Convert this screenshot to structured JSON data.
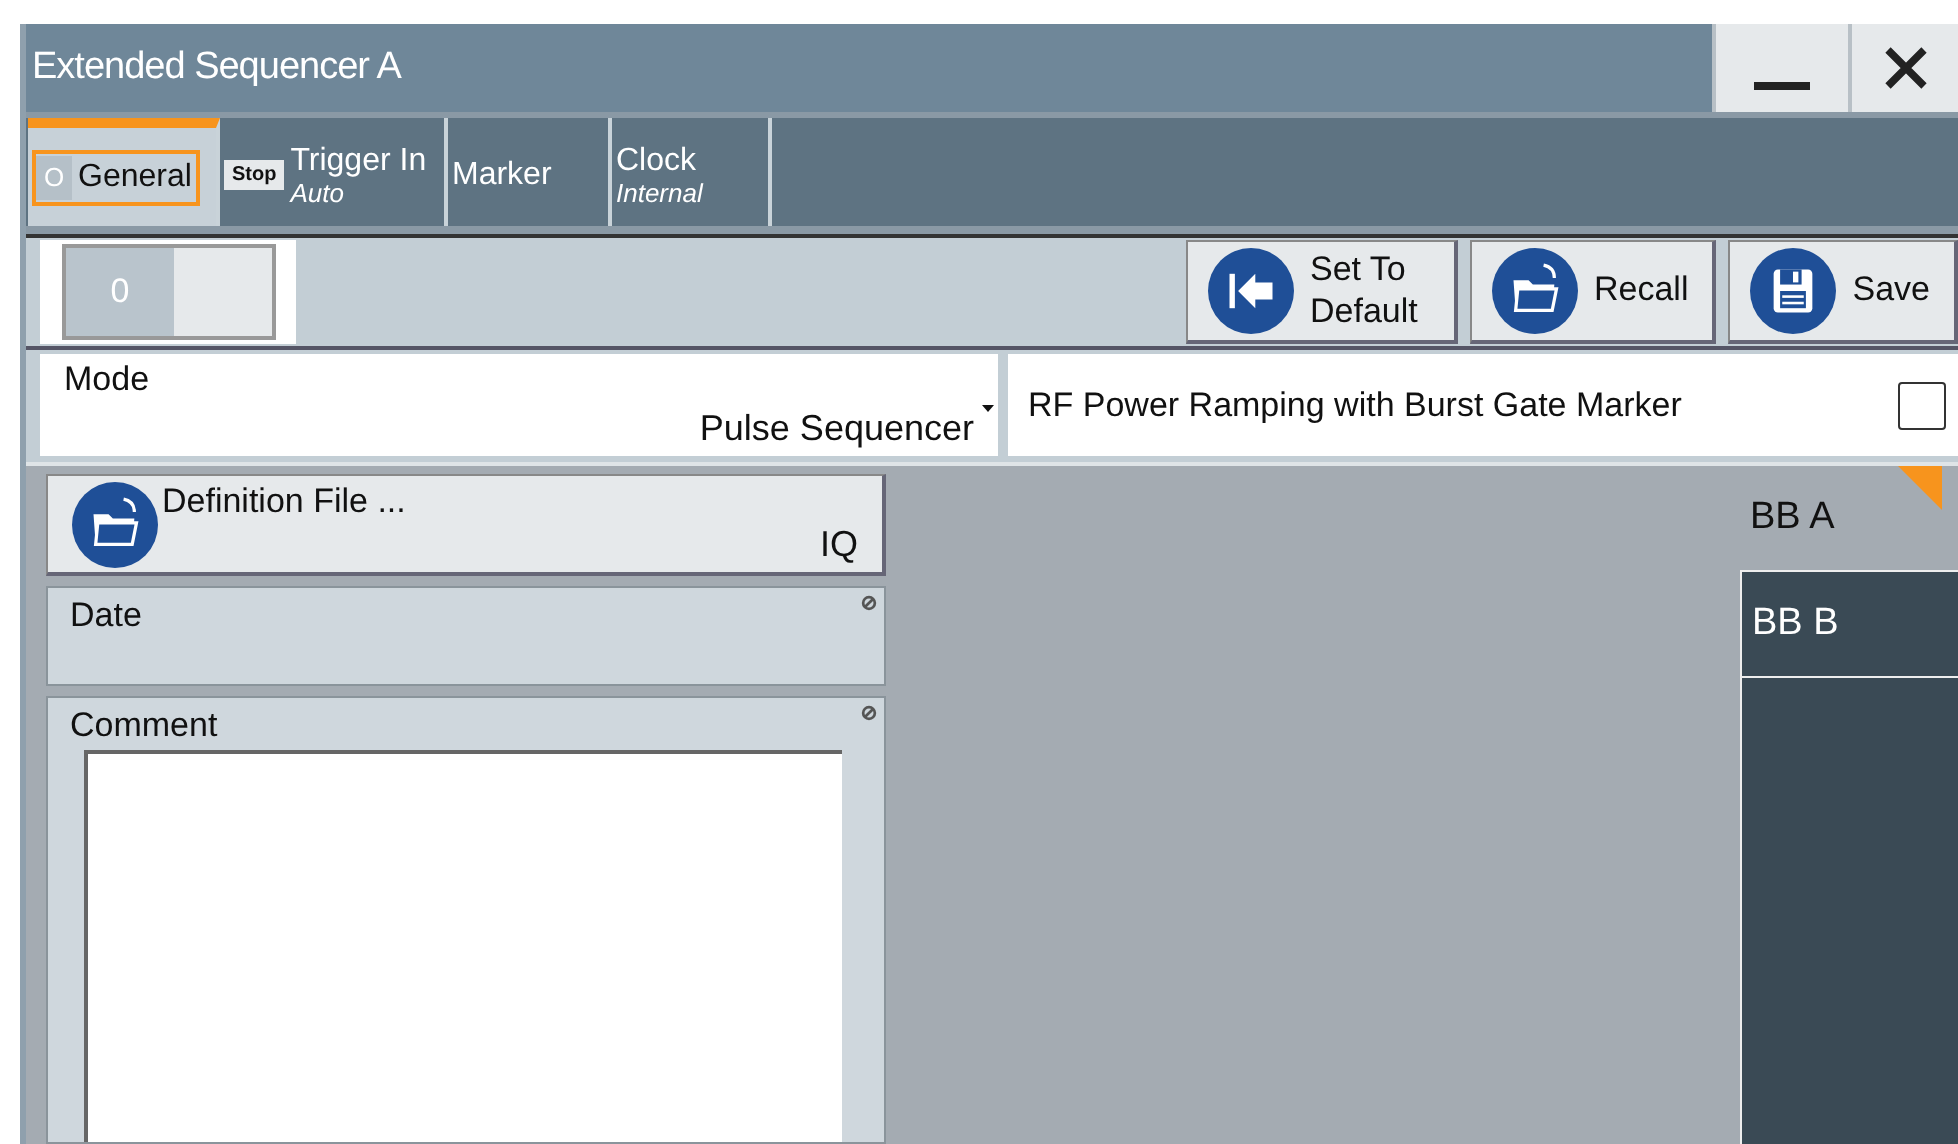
{
  "window": {
    "title": "Extended Sequencer A"
  },
  "tabs": [
    {
      "label": "General",
      "badge": "O",
      "selected": true
    },
    {
      "label": "Trigger In",
      "badge": "Stop",
      "sublabel": "Auto",
      "selected": false
    },
    {
      "label": "Marker",
      "selected": false
    },
    {
      "label": "Clock",
      "sublabel": "Internal",
      "selected": false
    }
  ],
  "state_switch": {
    "value": "0",
    "on": false
  },
  "toolbar_buttons": [
    {
      "label": "Set To Default",
      "kind": "default"
    },
    {
      "label": "Recall",
      "kind": "recall"
    },
    {
      "label": "Save",
      "kind": "save"
    }
  ],
  "mode": {
    "label": "Mode",
    "value": "Pulse Sequencer"
  },
  "rf_power_ramping": {
    "label": "RF Power Ramping with Burst Gate Marker",
    "checked": false
  },
  "definition_file": {
    "label": "Definition File ...",
    "value": "IQ"
  },
  "date": {
    "label": "Date"
  },
  "comment": {
    "label": "Comment"
  },
  "side_tabs": [
    {
      "label": "BB A",
      "selected": true
    },
    {
      "label": "BB B",
      "selected": false
    }
  ]
}
